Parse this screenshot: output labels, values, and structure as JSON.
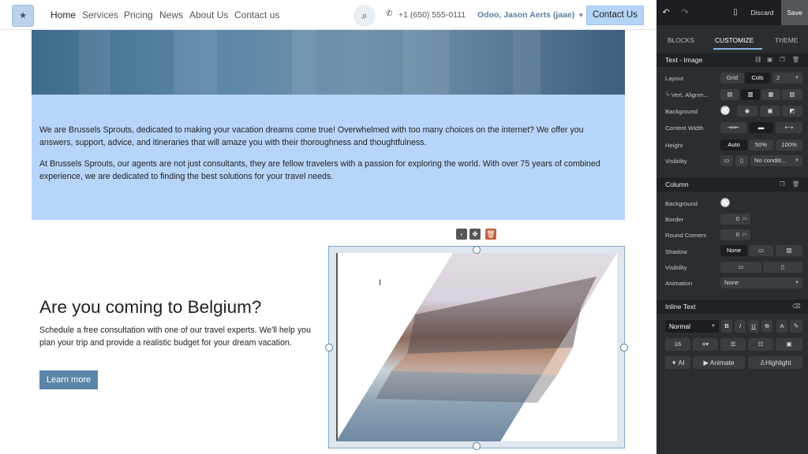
{
  "header": {
    "logo": "★",
    "nav": [
      "Home",
      "Services",
      "Pricing",
      "News",
      "About Us",
      "Contact us"
    ],
    "phone": "+1 (650) 555-0111",
    "user": "Odoo, Jason Aerts (jaae)",
    "contact_button": "Contact Us"
  },
  "about": {
    "p1": "We are Brussels Sprouts, dedicated to making your vacation dreams come true! Overwhelmed with too many choices on the internet? We offer you answers, support, advice, and itineraries that will amaze you with their thoroughness and thoughtfulness.",
    "p2": "At Brussels Sprouts, our agents are not just consultants, they are fellow travelers with a passion for exploring the world. With over 75 years of combined experience, we are dedicated to finding the best solutions for your travel needs."
  },
  "cta": {
    "title": "Are you coming to Belgium?",
    "text": "Schedule a free consultation with one of our travel experts. We'll help you plan your trip and provide a realistic budget for your dream vacation.",
    "button": "Learn more"
  },
  "sidebar": {
    "discard": "Discard",
    "save": "Save",
    "tabs": [
      "BLOCKS",
      "CUSTOMIZE",
      "THEME"
    ],
    "section_text_image": "Text - Image",
    "layout": "Layout",
    "layout_grid": "Grid",
    "layout_cols": "Cols",
    "layout_cols_count": "2",
    "vert_align": "└ Vert. Alignm...",
    "background": "Background",
    "content_width": "Content Width",
    "height": "Height",
    "height_auto": "Auto",
    "height_50": "50%",
    "height_100": "100%",
    "visibility": "Visibility",
    "visibility_value": "No conditi...",
    "section_column": "Column",
    "col_background": "Background",
    "border": "Border",
    "border_value": "0",
    "round_corners": "Round Corners",
    "round_value": "0",
    "px": "px",
    "shadow": "Shadow",
    "shadow_none": "None",
    "col_visibility": "Visibility",
    "animation": "Animation",
    "animation_value": "None",
    "section_inline": "Inline Text",
    "text_style": "Normal",
    "font_size": "16",
    "ai": "AI",
    "animate": "Animate",
    "highlight": "Highlight"
  },
  "colors": {
    "accent": "#b4d5f8",
    "band": "#b7d5fa",
    "button": "#5b86a8",
    "panel": "#2a2d31"
  }
}
